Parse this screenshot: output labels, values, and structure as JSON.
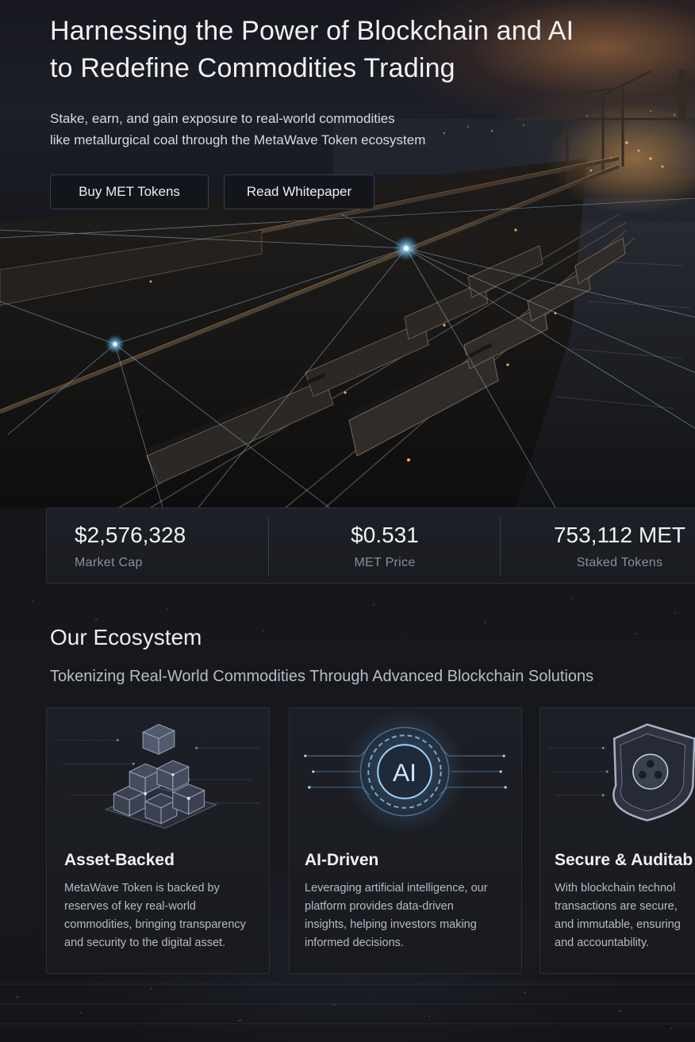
{
  "hero": {
    "title_line1": "Harnessing the Power of Blockchain and AI",
    "title_line2": "to Redefine Commodities Trading",
    "subtitle_line1": "Stake, earn, and gain exposure to real-world commodities",
    "subtitle_line2": "like metallurgical coal through the MetaWave Token ecosystem",
    "buttons": {
      "buy_label": "Buy MET Tokens",
      "whitepaper_label": "Read Whitepaper"
    }
  },
  "stats": [
    {
      "value": "$2,576,328",
      "label": "Market Cap"
    },
    {
      "value": "$0.531",
      "label": "MET Price"
    },
    {
      "value": "753,112 MET",
      "label": "Staked Tokens"
    }
  ],
  "ecosystem": {
    "title": "Our Ecosystem",
    "subtitle": "Tokenizing Real-World Commodities Through Advanced Blockchain Solutions",
    "cards": [
      {
        "icon": "cubes-icon",
        "title": "Asset-Backed",
        "body_lines": [
          "MetaWave Token is backed by",
          "reserves of key real-world",
          "commodities, bringing transparency",
          "and security to the digital asset."
        ]
      },
      {
        "icon": "ai-chip-icon",
        "icon_text": "AI",
        "title": "AI-Driven",
        "body_lines": [
          "Leveraging artificial intelligence, our",
          "platform provides data-driven",
          "insights, helping investors making",
          "informed decisions."
        ]
      },
      {
        "icon": "shield-icon",
        "title": "Secure & Auditab",
        "body_lines": [
          "With blockchain technol",
          "transactions are secure,",
          "and immutable, ensuring",
          "and accountability."
        ]
      }
    ]
  },
  "colors": {
    "background": "#15161b",
    "sunset_glow": "#e89650",
    "node_glow": "#8fd3ff",
    "border": "#2e313a"
  }
}
